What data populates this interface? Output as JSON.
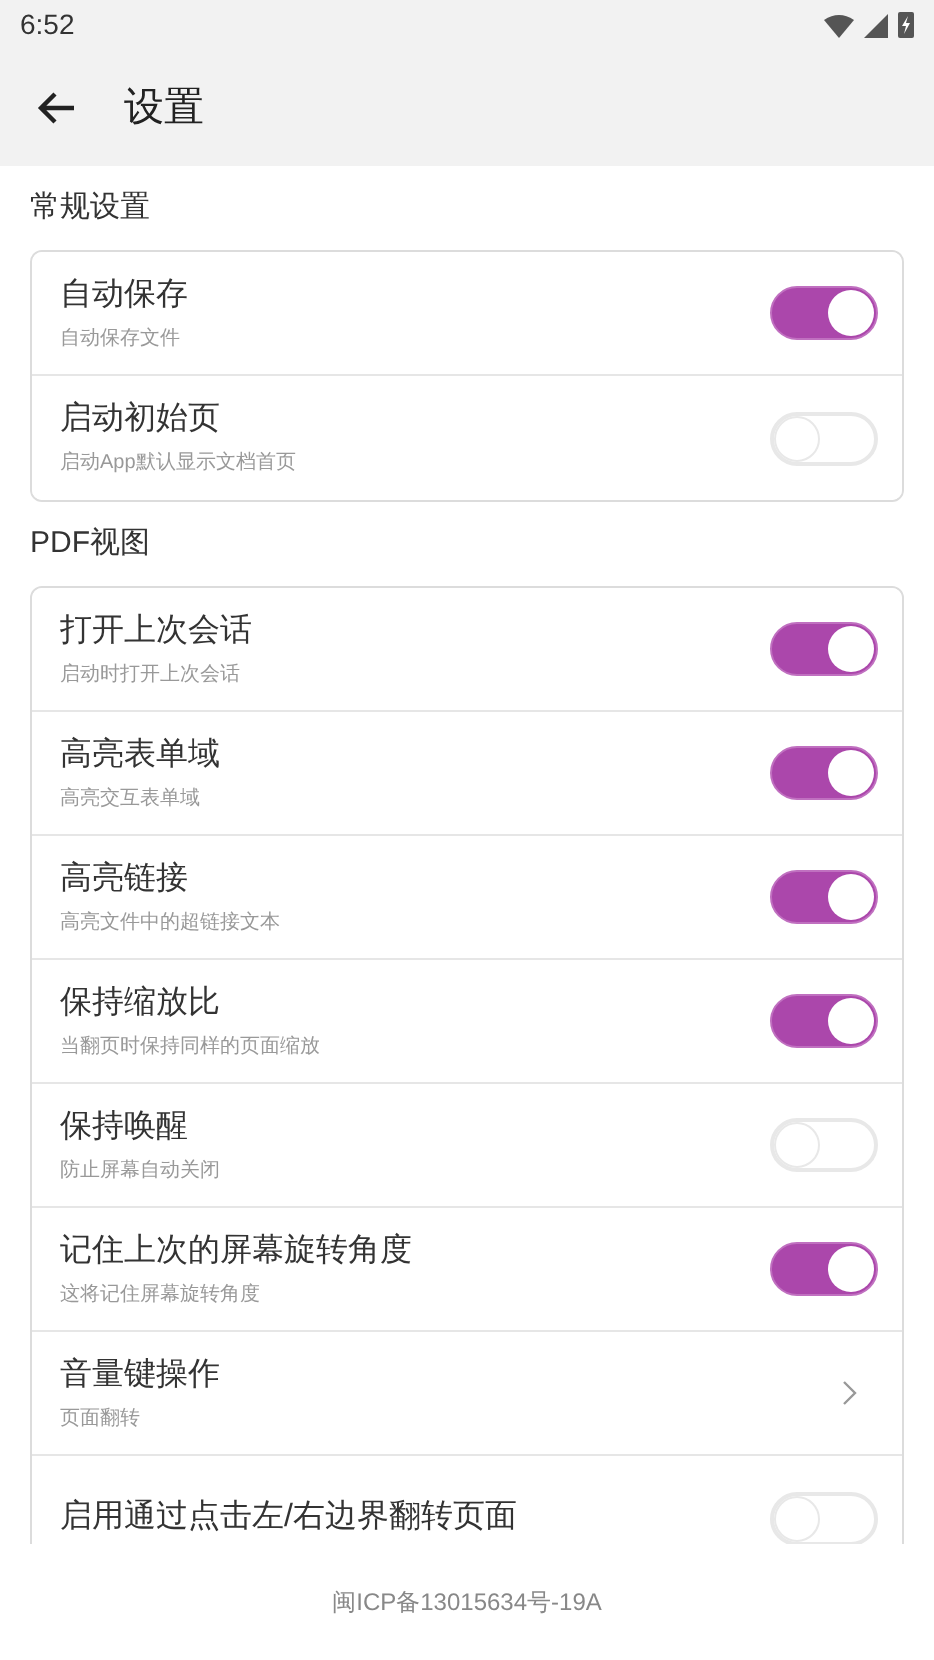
{
  "status_bar": {
    "time": "6:52"
  },
  "header": {
    "title": "设置"
  },
  "sections": [
    {
      "title": "常规设置",
      "items": [
        {
          "kind": "toggle",
          "title": "自动保存",
          "subtitle": "自动保存文件",
          "on": true
        },
        {
          "kind": "toggle",
          "title": "启动初始页",
          "subtitle": "启动App默认显示文档首页",
          "on": false
        }
      ]
    },
    {
      "title": "PDF视图",
      "items": [
        {
          "kind": "toggle",
          "title": "打开上次会话",
          "subtitle": "启动时打开上次会话",
          "on": true
        },
        {
          "kind": "toggle",
          "title": "高亮表单域",
          "subtitle": "高亮交互表单域",
          "on": true
        },
        {
          "kind": "toggle",
          "title": "高亮链接",
          "subtitle": "高亮文件中的超链接文本",
          "on": true
        },
        {
          "kind": "toggle",
          "title": "保持缩放比",
          "subtitle": "当翻页时保持同样的页面缩放",
          "on": true
        },
        {
          "kind": "toggle",
          "title": "保持唤醒",
          "subtitle": "防止屏幕自动关闭",
          "on": false
        },
        {
          "kind": "toggle",
          "title": "记住上次的屏幕旋转角度",
          "subtitle": "这将记住屏幕旋转角度",
          "on": true
        },
        {
          "kind": "link",
          "title": "音量键操作",
          "subtitle": "页面翻转"
        },
        {
          "kind": "toggle",
          "title": "启用通过点击左/右边界翻转页面",
          "on": false
        }
      ]
    }
  ],
  "footer": {
    "text": "闽ICP备13015634号-19A"
  }
}
